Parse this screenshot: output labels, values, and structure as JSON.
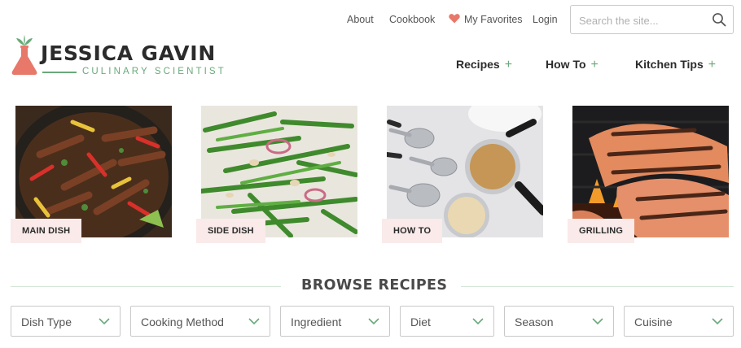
{
  "utility_nav": {
    "links": [
      {
        "label": "About"
      },
      {
        "label": "Cookbook"
      },
      {
        "label": "My Favorites"
      },
      {
        "label": "Login"
      }
    ],
    "search_placeholder": "Search the site..."
  },
  "logo": {
    "name": "JESSICA GAVIN",
    "tagline": "CULINARY SCIENTIST"
  },
  "main_nav": [
    {
      "label": "Recipes"
    },
    {
      "label": "How To"
    },
    {
      "label": "Kitchen Tips"
    }
  ],
  "cards": [
    {
      "label": "MAIN DISH"
    },
    {
      "label": "SIDE DISH"
    },
    {
      "label": "HOW TO"
    },
    {
      "label": "GRILLING"
    }
  ],
  "browse": {
    "title": "BROWSE RECIPES",
    "filters": [
      {
        "label": "Dish Type"
      },
      {
        "label": "Cooking Method"
      },
      {
        "label": "Ingredient"
      },
      {
        "label": "Diet"
      },
      {
        "label": "Season"
      },
      {
        "label": "Cuisine"
      }
    ]
  },
  "colors": {
    "accent_green": "#6aa97a",
    "accent_coral": "#e8786a",
    "card_label_bg": "#faeaea"
  }
}
